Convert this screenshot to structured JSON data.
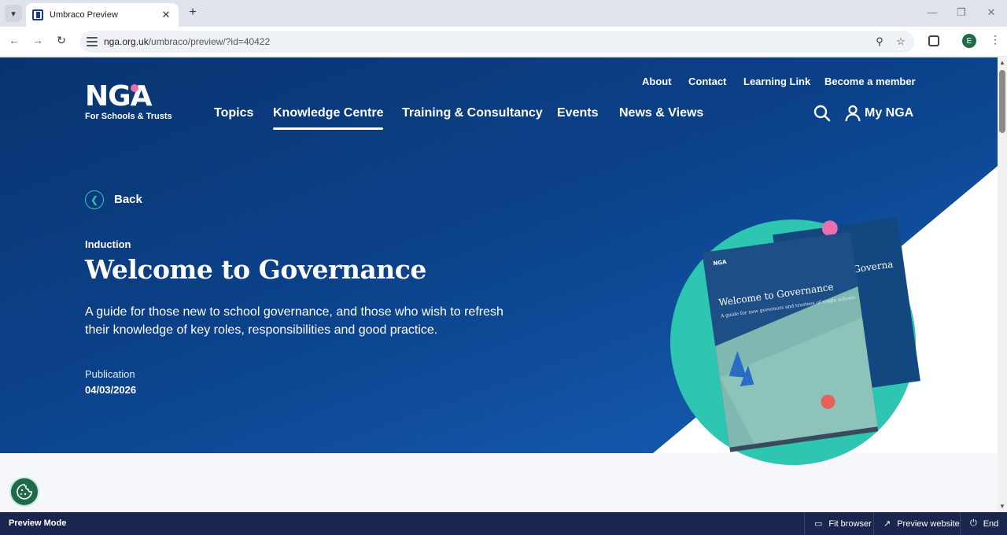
{
  "browser": {
    "tab_title": "Umbraco Preview",
    "url_host": "nga.org.uk",
    "url_path": "/umbraco/preview/?id=40422",
    "profile_initial": "E"
  },
  "site": {
    "logo_text": "NGA",
    "logo_sub": "For Schools & Trusts",
    "utility_nav": [
      "About",
      "Contact",
      "Learning Link",
      "Become a member"
    ],
    "main_nav": [
      "Topics",
      "Knowledge Centre",
      "Training & Consultancy",
      "Events",
      "News & Views"
    ],
    "active_nav": "Knowledge Centre",
    "account_label": "My NGA"
  },
  "hero": {
    "back_label": "Back",
    "eyebrow": "Induction",
    "title": "Welcome to Governance",
    "description": "A guide for those new to school governance, and those who wish to refresh their knowledge of key roles, responsibilities and good practice.",
    "publication_label": "Publication",
    "publication_date": "04/03/2026",
    "book_title": "Welcome to Governance",
    "book_subtitle": "A guide for new governors and trustees of single schools",
    "book_back_title": "Governa"
  },
  "preview_bar": {
    "mode_label": "Preview Mode",
    "fit_browser": "Fit browser",
    "preview_website": "Preview website",
    "end": "End"
  },
  "colors": {
    "hero_dark": "#0a3470",
    "hero_light": "#1660b8",
    "teal": "#2ec6b0",
    "pink": "#e86fb0",
    "preview_bar": "#1b264f"
  }
}
